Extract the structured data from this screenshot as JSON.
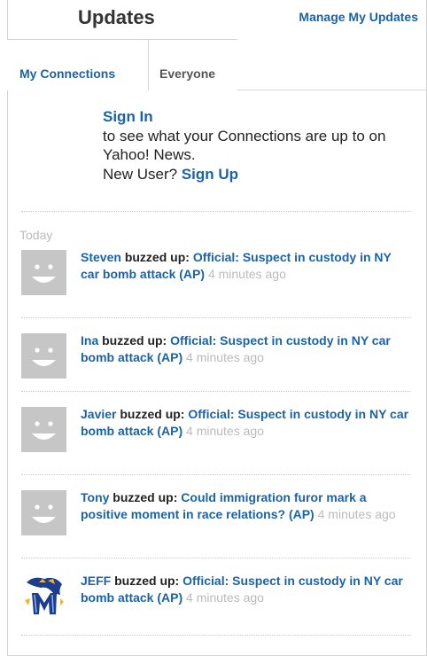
{
  "header": {
    "title": "Updates",
    "manage_link": "Manage My Updates"
  },
  "tabs": {
    "my_connections": "My Connections",
    "everyone": "Everyone"
  },
  "signin": {
    "link": "Sign In",
    "message": "to see what your Connections are up to on Yahoo! News.",
    "new_user": "New User?",
    "signup_link": "Sign Up"
  },
  "feed": {
    "section_label": "Today",
    "items": [
      {
        "name": "Steven",
        "action": "buzzed up:",
        "headline": "Official: Suspect in custody in NY car bomb attack (AP)",
        "time": "4 minutes ago",
        "avatar": "default-face-icon"
      },
      {
        "name": "Ina",
        "action": "buzzed up:",
        "headline": "Official: Suspect in custody in NY car bomb attack (AP)",
        "time": "4 minutes ago",
        "avatar": "default-face-icon"
      },
      {
        "name": "Javier",
        "action": "buzzed up:",
        "headline": "Official: Suspect in custody in NY car bomb attack (AP)",
        "time": "4 minutes ago",
        "avatar": "default-face-icon"
      },
      {
        "name": "Tony",
        "action": "buzzed up:",
        "headline": "Could immigration furor mark a positive moment in race relations? (AP)",
        "time": "4 minutes ago",
        "avatar": "default-face-icon"
      },
      {
        "name": "JEFF",
        "action": "buzzed up:",
        "headline": "Official: Suspect in custody in NY car bomb attack (AP)",
        "time": "4 minutes ago",
        "avatar": "tiger-mascot-logo"
      }
    ]
  },
  "colors": {
    "link": "#1a63a8",
    "muted": "#bbbbbb",
    "avatar_bg": "#c6c6c6",
    "border": "#d4d4d4"
  }
}
